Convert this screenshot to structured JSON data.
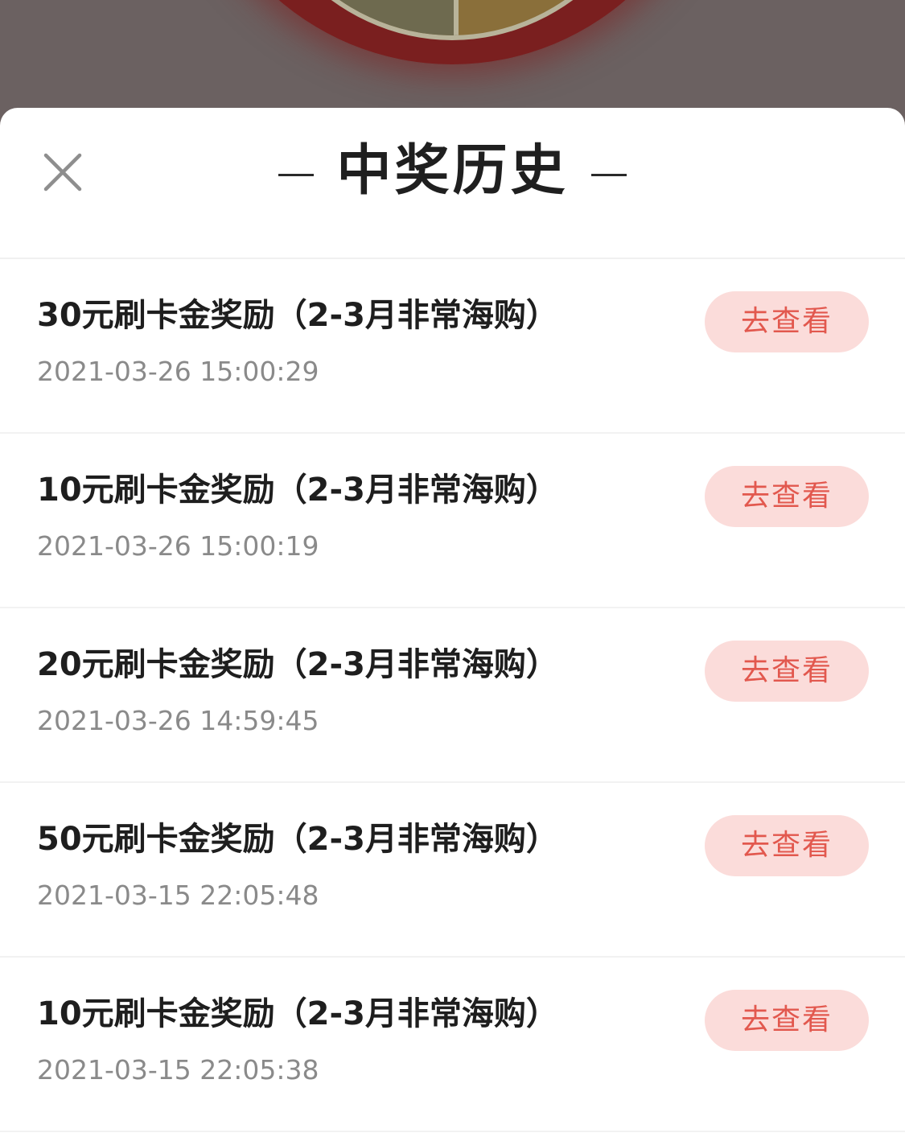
{
  "header": {
    "title": "中奖历史"
  },
  "colors": {
    "accent": "#e2584e",
    "button_bg": "#fbdcda",
    "backdrop": "#6b6161"
  },
  "prizes": [
    {
      "title": "30元刷卡金奖励（2-3月非常海购）",
      "time": "2021-03-26 15:00:29",
      "button": "去查看"
    },
    {
      "title": "10元刷卡金奖励（2-3月非常海购）",
      "time": "2021-03-26 15:00:19",
      "button": "去查看"
    },
    {
      "title": "20元刷卡金奖励（2-3月非常海购）",
      "time": "2021-03-26 14:59:45",
      "button": "去查看"
    },
    {
      "title": "50元刷卡金奖励（2-3月非常海购）",
      "time": "2021-03-15 22:05:48",
      "button": "去查看"
    },
    {
      "title": "10元刷卡金奖励（2-3月非常海购）",
      "time": "2021-03-15 22:05:38",
      "button": "去查看"
    }
  ]
}
